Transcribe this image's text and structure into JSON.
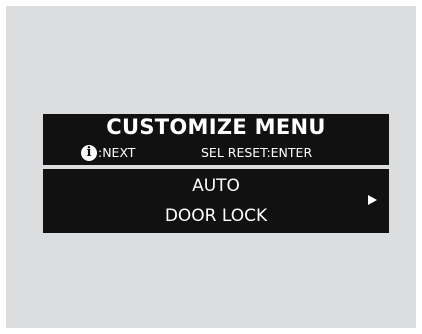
{
  "menu": {
    "title": "CUSTOMIZE MENU",
    "info_icon_glyph": "i",
    "hint_next": ":NEXT",
    "hint_reset": "SEL RESET:ENTER"
  },
  "item": {
    "line1": "AUTO",
    "line2": "DOOR LOCK",
    "arrow_icon": "right-triangle-icon"
  },
  "colors": {
    "panel": "#111111",
    "background": "#dcdddf",
    "text": "#ffffff"
  }
}
